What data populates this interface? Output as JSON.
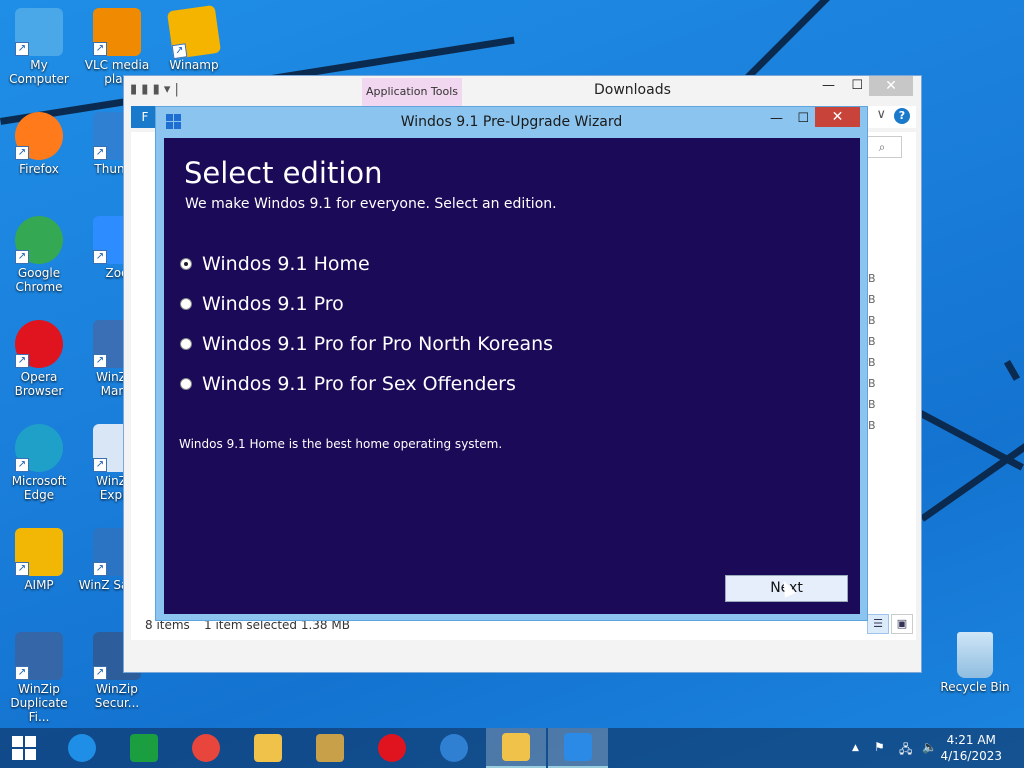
{
  "desktop": {
    "icons_col1": [
      {
        "label": "My Computer",
        "color": "#4aa7e8"
      },
      {
        "label": "Firefox",
        "color": "#ff7a1a"
      },
      {
        "label": "Google Chrome",
        "color": "#34a853"
      },
      {
        "label": "Opera Browser",
        "color": "#e0141e"
      },
      {
        "label": "Microsoft Edge",
        "color": "#1fa0c8"
      },
      {
        "label": "AIMP",
        "color": "#f2b705"
      },
      {
        "label": "WinZip Duplicate Fi...",
        "color": "#3466a8"
      }
    ],
    "icons_col2": [
      {
        "label": "VLC media play",
        "color": "#f08a00"
      },
      {
        "label": "Thunde",
        "color": "#2f7fd3"
      },
      {
        "label": "Zoo",
        "color": "#2d8cff"
      },
      {
        "label": "WinZip Mana",
        "color": "#3a6fb6"
      },
      {
        "label": "WinZip Expre",
        "color": "#d9e6f5"
      },
      {
        "label": "WinZ SafeSh",
        "color": "#2b74c4"
      },
      {
        "label": "WinZip Secur...",
        "color": "#2d5d9a"
      }
    ],
    "winamp": {
      "label": "Winamp",
      "color": "#f4b400"
    },
    "recycle_bin": {
      "label": "Recycle Bin"
    }
  },
  "explorer": {
    "title": "Downloads",
    "app_tools_tab": "Application Tools",
    "file_tab": "F",
    "help": "?",
    "chevron": "∨",
    "search_icon": "⌕",
    "size_col": [
      "B",
      "B",
      "B",
      "B",
      "B",
      "B",
      "B",
      "B"
    ],
    "status_items": "8 items",
    "status_selected": "1 item selected  1.38 MB",
    "minimize": "—",
    "maximize": "☐",
    "close": "✕"
  },
  "wizard": {
    "title": "Windos 9.1 Pre-Upgrade Wizard",
    "heading": "Select edition",
    "subtitle": "We make Windos 9.1 for everyone. Select an edition.",
    "options": [
      {
        "label": "Windos 9.1 Home",
        "checked": true
      },
      {
        "label": "Windos 9.1 Pro",
        "checked": false
      },
      {
        "label": "Windos 9.1 Pro for Pro North Koreans",
        "checked": false
      },
      {
        "label": "Windos 9.1 Pro for Sex Offenders",
        "checked": false
      }
    ],
    "description": "Windos 9.1 Home is the best home operating system.",
    "next_label": "Next",
    "minimize": "—",
    "maximize": "☐",
    "close": "✕"
  },
  "taskbar": {
    "start_icon": "windows-logo",
    "apps": [
      {
        "name": "internet-explorer",
        "color": "#1f8ee6"
      },
      {
        "name": "store",
        "color": "#1a9e3f"
      },
      {
        "name": "chrome",
        "color": "#e8453c"
      },
      {
        "name": "file-explorer",
        "color": "#f0c24a"
      },
      {
        "name": "winrar",
        "color": "#c9a04a"
      },
      {
        "name": "opera",
        "color": "#e0141e"
      },
      {
        "name": "thunderbird",
        "color": "#2f7fd3"
      },
      {
        "name": "file-explorer-active",
        "color": "#f0c24a"
      },
      {
        "name": "windows-app-active",
        "color": "#2a8ae6"
      }
    ],
    "time": "4:21 AM",
    "date": "4/16/2023",
    "tray_up": "▲"
  }
}
